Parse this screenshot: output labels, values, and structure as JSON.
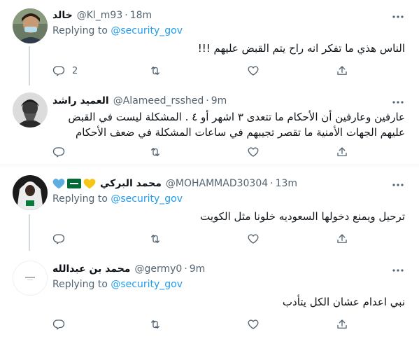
{
  "tweets": [
    {
      "name": "خالد",
      "handle": "@Kl_m93",
      "separator": "·",
      "time": "18m",
      "replying_prefix": "Replying to ",
      "replying_to": "@security_gov",
      "text": "الناس هذي ما تفكر انه راح يتم القبض عليهم !!!",
      "reply_count": "2"
    },
    {
      "name": "العميد راشد",
      "handle": "@Alameed_rsshed",
      "separator": "·",
      "time": "9m",
      "text_line1": "عارفين وعارفين أن الأحكام ما تتعدى ٣ اشهر أو ٤ . المشكلة ليست في القبض",
      "text_line2": "عليهم الجهات الأمنية ما تقصر تجيبهم في ساعات المشكلة في ضعف الأحكام"
    },
    {
      "name": "محمد البركي",
      "handle": "@MOHAMMAD30304",
      "separator": "·",
      "time": "13m",
      "replying_prefix": "Replying to ",
      "replying_to": "@security_gov",
      "text": "ترحيل ويمنع دخولها السعوديه خلونا مثل الكويت"
    },
    {
      "name": "محمد بن عبدالله",
      "handle": "@germy0",
      "separator": "·",
      "time": "9m",
      "replying_prefix": "Replying to ",
      "replying_to": "@security_gov",
      "text": "نبي اعدام عشان الكل يتأدب"
    }
  ],
  "icons": {
    "reply": "reply-icon",
    "retweet": "retweet-icon",
    "like": "heart-icon",
    "share": "share-icon",
    "more": "more-icon"
  },
  "colors": {
    "text": "#0f1419",
    "secondary": "#536471",
    "accent": "#1d9bf0",
    "divider": "#eff3f4",
    "thread_line": "#cfd9de"
  }
}
